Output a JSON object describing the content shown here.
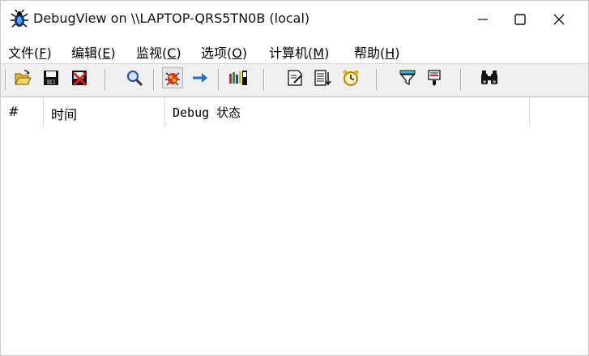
{
  "window": {
    "title": "DebugView on \\\\LAPTOP-QRS5TN0B (local)",
    "icons": {
      "app": "debugview-bug-icon",
      "minimize": "minimize-icon",
      "maximize": "maximize-icon",
      "close": "close-icon"
    }
  },
  "menu": {
    "items": [
      {
        "label": "文件(",
        "accel": "F",
        "tail": ")"
      },
      {
        "label": "编辑(",
        "accel": "E",
        "tail": ")"
      },
      {
        "label": "监视(",
        "accel": "C",
        "tail": ")"
      },
      {
        "label": "选项(",
        "accel": "O",
        "tail": ")"
      },
      {
        "label": "计算机(",
        "accel": "M",
        "tail": ")"
      },
      {
        "label": "帮助(",
        "accel": "H",
        "tail": ")"
      }
    ]
  },
  "toolbar": {
    "buttons": [
      {
        "icon": "open-folder-icon"
      },
      {
        "icon": "save-disk-icon"
      },
      {
        "icon": "clear-display-icon"
      },
      {
        "icon": "capture-magnifier-icon"
      },
      {
        "icon": "capture-win32-icon",
        "pressed": true
      },
      {
        "icon": "autoscroll-arrow-icon"
      },
      {
        "icon": "history-depth-icon"
      },
      {
        "icon": "edit-note-icon"
      },
      {
        "icon": "clock-time-icon"
      },
      {
        "icon": "alarm-clock-icon"
      },
      {
        "icon": "filter-funnel-icon"
      },
      {
        "icon": "highlight-icon"
      },
      {
        "icon": "find-binoculars-icon"
      }
    ]
  },
  "listview": {
    "columns": [
      "#",
      "时间",
      "Debug 状态"
    ],
    "rows": []
  },
  "colors": {
    "toolbar_bg": "#f0f0f0",
    "separator": "#a8a8a8"
  }
}
